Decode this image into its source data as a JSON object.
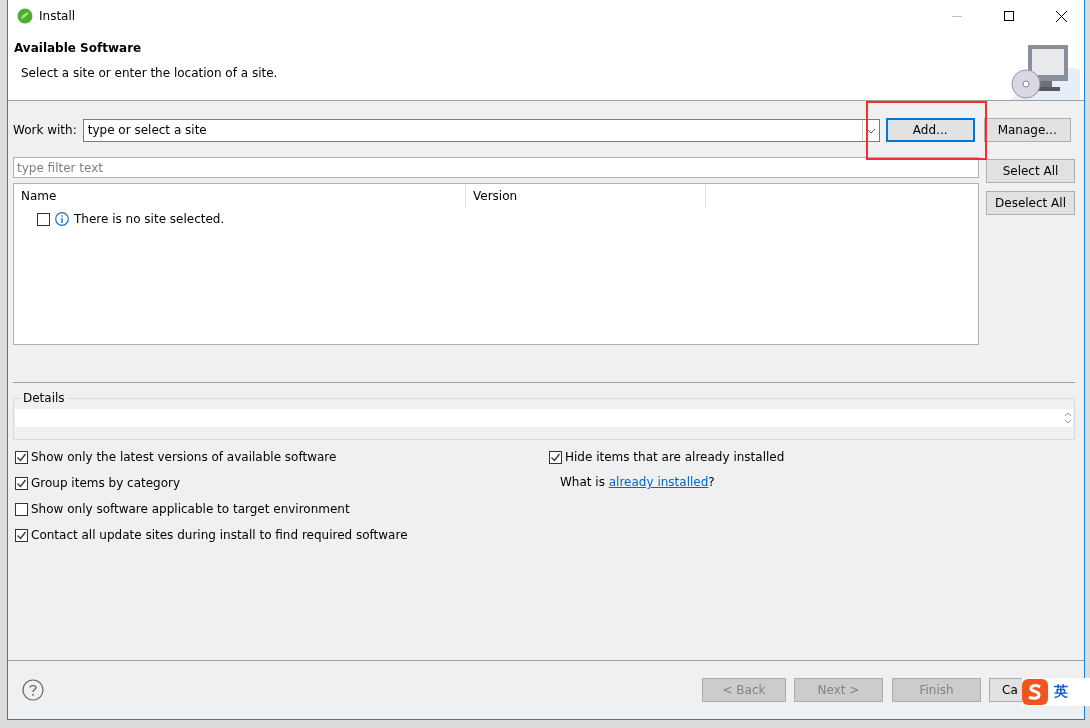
{
  "window": {
    "title": "Install"
  },
  "header": {
    "title": "Available Software",
    "subtitle": "Select a site or enter the location of a site."
  },
  "work_with": {
    "label": "Work with:",
    "value": "type or select a site",
    "add_button": "Add...",
    "manage_button": "Manage...",
    "highlighted": true
  },
  "filter": {
    "placeholder": "type filter text"
  },
  "side_buttons": [
    "Select All",
    "Deselect All"
  ],
  "table": {
    "columns": [
      "Name",
      "Version"
    ],
    "rows": [
      {
        "checked": false,
        "text": "There is no site selected."
      }
    ]
  },
  "details": {
    "label": "Details"
  },
  "options_left": [
    {
      "label": "Show only the latest versions of available software",
      "checked": true
    },
    {
      "label": "Group items by category",
      "checked": true
    },
    {
      "label": "Show only software applicable to target environment",
      "checked": false
    },
    {
      "label": "Contact all update sites during install to find required software",
      "checked": true
    }
  ],
  "options_right": [
    {
      "label": "Hide items that are already installed",
      "checked": true
    }
  ],
  "installed_hint": {
    "prefix": "What is ",
    "link": "already installed",
    "suffix": "?"
  },
  "footer_buttons": [
    {
      "label": "< Back",
      "disabled": true
    },
    {
      "label": "Next >",
      "disabled": true
    },
    {
      "label": "Finish",
      "disabled": true
    },
    {
      "label": "Ca",
      "disabled": false
    }
  ],
  "ime": {
    "mode": "英"
  }
}
